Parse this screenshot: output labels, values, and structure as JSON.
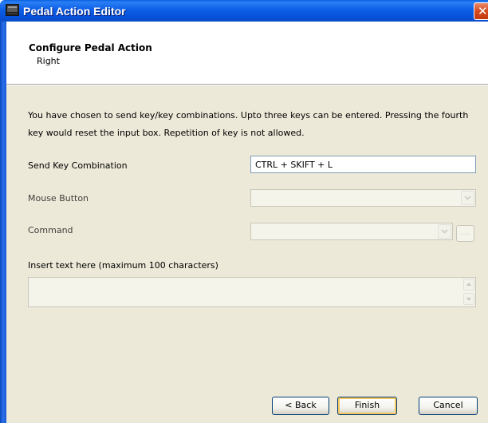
{
  "window": {
    "title": "Pedal Action Editor"
  },
  "header": {
    "title": "Configure Pedal Action",
    "subtitle": "Right"
  },
  "instructions": {
    "line1": "You have chosen to send key/key combinations. Upto three keys can be entered. Pressing the fourth",
    "line2": "key would reset the input box. Repetition of key is not allowed."
  },
  "form": {
    "send_key_label": "Send Key Combination",
    "send_key_value": "CTRL + SKIFT + L",
    "mouse_button_label": "Mouse Button",
    "mouse_button_value": "",
    "command_label": "Command",
    "command_value": "",
    "command_browse_label": "...",
    "insert_text_label": "Insert text here (maximum 100 characters)",
    "insert_text_value": ""
  },
  "buttons": {
    "back": "< Back",
    "finish": "Finish",
    "cancel": "Cancel"
  },
  "icons": {
    "app": "pedal-window-icon",
    "close": "close-icon",
    "dropdown": "chevron-down-icon",
    "scroll_up": "scroll-up-icon",
    "scroll_down": "scroll-down-icon"
  },
  "colors": {
    "titlebar": "#0a5fe0",
    "close_button": "#d64a1e",
    "dialog_face": "#ece9d8",
    "header_bg": "#ffffff",
    "textbox_border": "#7f9db9",
    "button_border": "#003c74",
    "default_focus": "#f6c75f"
  }
}
